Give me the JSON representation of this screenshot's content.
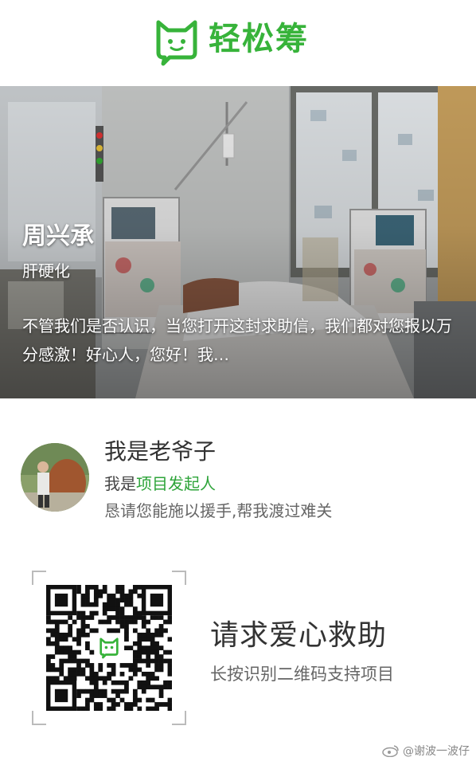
{
  "brand": {
    "name": "轻松筹",
    "accent_color": "#37b33a"
  },
  "hero": {
    "patient_name": "周兴承",
    "condition": "肝硬化",
    "excerpt": "不管我们是否认识，当您打开这封求助信，我们都对您报以万分感激！好心人，您好！我…",
    "image_subject": "hospital-dialysis-room-photo"
  },
  "initiator": {
    "name": "我是老爷子",
    "role_prefix": "我是",
    "role_highlight": "项目发起人",
    "plea": "恳请您能施以援手,帮我渡过难关"
  },
  "cta": {
    "title": "请求爱心救助",
    "subtitle": "长按识别二维码支持项目"
  },
  "watermark": {
    "text": "@谢波一波仔",
    "icon": "weibo-icon"
  }
}
